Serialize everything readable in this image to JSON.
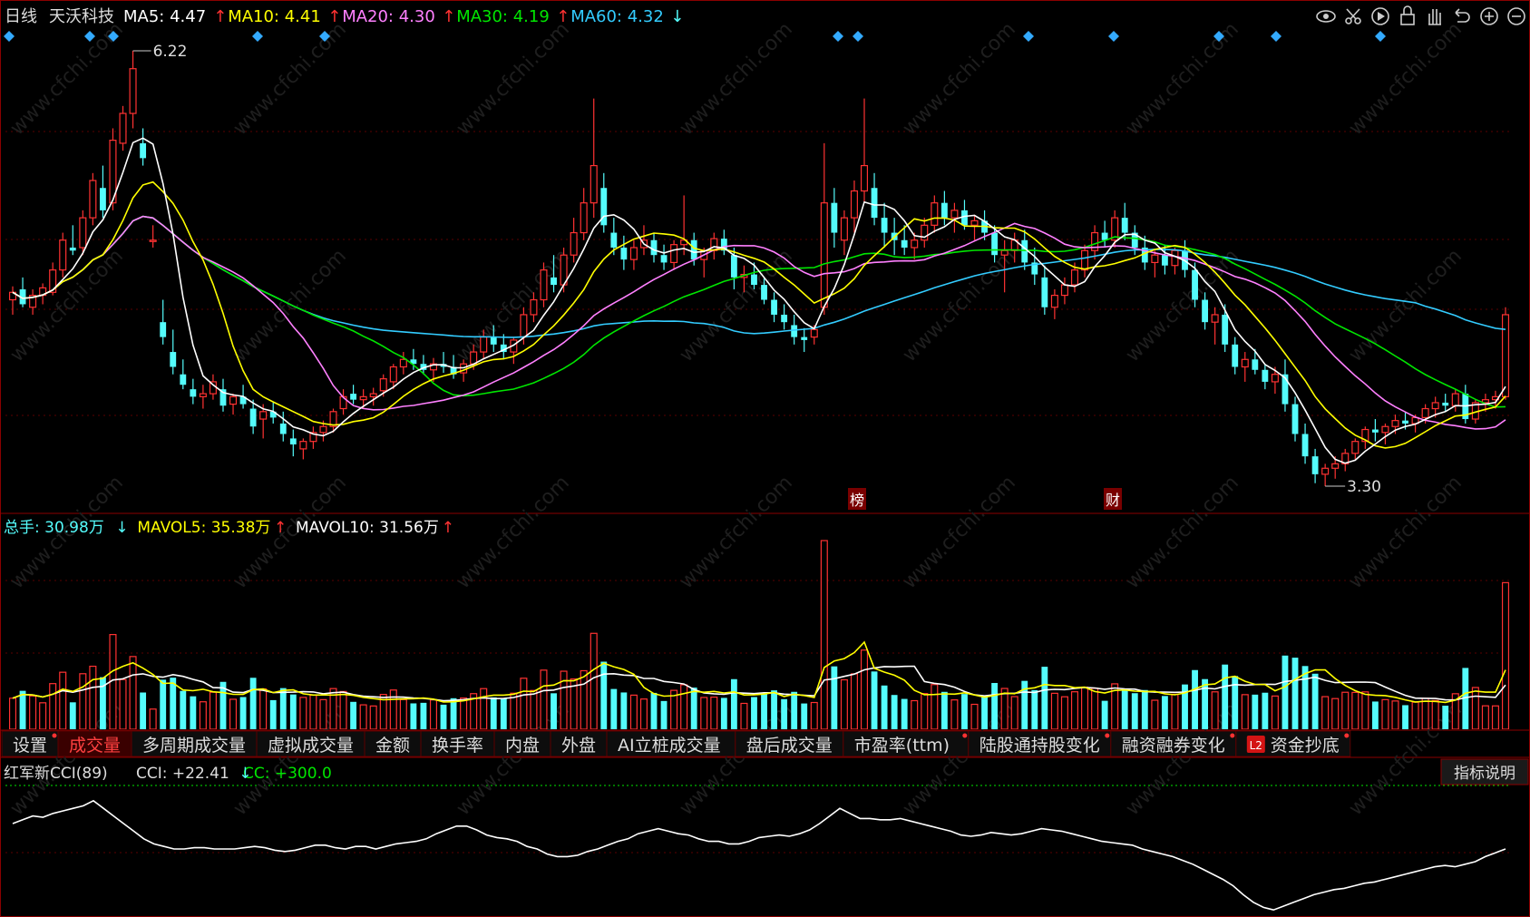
{
  "header": {
    "period": "日线",
    "stock_name": "天沃科技",
    "ma": [
      {
        "label": "MA5: 4.47",
        "arrow": "↑",
        "color": "#ffffff"
      },
      {
        "label": "MA10: 4.41",
        "arrow": "↑",
        "color": "#ffff00"
      },
      {
        "label": "MA20: 4.30",
        "arrow": "↑",
        "color": "#ff80ff"
      },
      {
        "label": "MA30: 4.19",
        "arrow": "↑",
        "color": "#00e600"
      },
      {
        "label": "MA60: 4.32",
        "arrow": "↓",
        "color": "#33ccff"
      }
    ]
  },
  "toolbar_icons": [
    "eye-icon",
    "scissors-icon",
    "replay-icon",
    "lock-icon",
    "hand-icon",
    "undo-icon",
    "zoom-in-icon",
    "zoom-out-icon"
  ],
  "price_panel": {
    "high_label": "6.22",
    "low_label": "3.30",
    "event_marks": [
      "榜",
      "财"
    ],
    "watermark": "www.cfchi.com"
  },
  "volume_panel": {
    "total": {
      "label": "总手: 30.98万",
      "arrow": "↓"
    },
    "mavol5": {
      "label": "MAVOL5: 35.38万",
      "arrow": "↑"
    },
    "mavol10": {
      "label": "MAVOL10: 31.56万",
      "arrow": "↑"
    }
  },
  "tabs": [
    {
      "label": "设置",
      "dot": true
    },
    {
      "label": "成交量",
      "active": true
    },
    {
      "label": "多周期成交量"
    },
    {
      "label": "虚拟成交量"
    },
    {
      "label": "金额"
    },
    {
      "label": "换手率"
    },
    {
      "label": "内盘"
    },
    {
      "label": "外盘"
    },
    {
      "label": "AI立桩成交量"
    },
    {
      "label": "盘后成交量"
    },
    {
      "label": "市盈率(ttm)",
      "dot": true
    },
    {
      "label": "陆股通持股变化",
      "dot": true
    },
    {
      "label": "融资融券变化",
      "dot": true
    },
    {
      "label": "资金抄底",
      "badge": "L2",
      "dot": true
    }
  ],
  "cci_panel": {
    "name": "红军新CCI(89)",
    "cci": "CCI: +22.41",
    "cci_arrow": "↓",
    "cc": "CC: +300.0",
    "explain_button": "指标说明"
  },
  "colors": {
    "up": "#ff3232",
    "down": "#54fcfc",
    "ma5": "#ffffff",
    "ma10": "#ffff00",
    "ma20": "#ff80ff",
    "ma30": "#00e600",
    "ma60": "#33ccff",
    "frame": "#8b0000"
  },
  "chart_data": {
    "type": "candlestick",
    "note_axis": "daily candles, oldest to newest",
    "candles": [
      [
        4.55,
        4.64,
        4.45,
        4.6
      ],
      [
        4.62,
        4.7,
        4.5,
        4.52
      ],
      [
        4.5,
        4.62,
        4.45,
        4.58
      ],
      [
        4.58,
        4.66,
        4.52,
        4.63
      ],
      [
        4.6,
        4.8,
        4.58,
        4.75
      ],
      [
        4.75,
        5.0,
        4.7,
        4.95
      ],
      [
        4.9,
        5.05,
        4.85,
        4.88
      ],
      [
        4.9,
        5.15,
        4.85,
        5.1
      ],
      [
        5.1,
        5.4,
        5.05,
        5.35
      ],
      [
        5.3,
        5.45,
        5.1,
        5.15
      ],
      [
        5.2,
        5.7,
        5.15,
        5.62
      ],
      [
        5.6,
        5.85,
        5.55,
        5.8
      ],
      [
        5.8,
        6.22,
        5.7,
        6.1
      ],
      [
        5.6,
        5.7,
        5.45,
        5.5
      ],
      [
        4.95,
        5.05,
        4.9,
        4.95
      ],
      [
        4.4,
        4.55,
        4.25,
        4.3
      ],
      [
        4.2,
        4.35,
        4.05,
        4.1
      ],
      [
        4.05,
        4.15,
        3.95,
        3.98
      ],
      [
        3.95,
        4.02,
        3.85,
        3.9
      ],
      [
        3.9,
        3.98,
        3.82,
        3.92
      ],
      [
        3.92,
        4.05,
        3.88,
        4.0
      ],
      [
        3.95,
        4.02,
        3.8,
        3.84
      ],
      [
        3.85,
        3.92,
        3.78,
        3.9
      ],
      [
        3.9,
        3.98,
        3.82,
        3.85
      ],
      [
        3.82,
        3.88,
        3.65,
        3.7
      ],
      [
        3.75,
        3.85,
        3.62,
        3.8
      ],
      [
        3.8,
        3.86,
        3.72,
        3.76
      ],
      [
        3.72,
        3.8,
        3.6,
        3.65
      ],
      [
        3.62,
        3.68,
        3.5,
        3.58
      ],
      [
        3.55,
        3.62,
        3.48,
        3.6
      ],
      [
        3.6,
        3.7,
        3.55,
        3.66
      ],
      [
        3.66,
        3.74,
        3.6,
        3.7
      ],
      [
        3.7,
        3.82,
        3.66,
        3.8
      ],
      [
        3.82,
        3.95,
        3.78,
        3.9
      ],
      [
        3.92,
        3.98,
        3.85,
        3.88
      ],
      [
        3.88,
        3.95,
        3.82,
        3.9
      ],
      [
        3.9,
        3.96,
        3.84,
        3.92
      ],
      [
        3.94,
        4.05,
        3.9,
        4.02
      ],
      [
        4.0,
        4.12,
        3.95,
        4.1
      ],
      [
        4.1,
        4.2,
        4.05,
        4.15
      ],
      [
        4.15,
        4.22,
        4.08,
        4.12
      ],
      [
        4.12,
        4.18,
        4.05,
        4.08
      ],
      [
        4.08,
        4.16,
        4.0,
        4.12
      ],
      [
        4.12,
        4.2,
        4.06,
        4.1
      ],
      [
        4.1,
        4.18,
        4.02,
        4.05
      ],
      [
        4.06,
        4.15,
        4.0,
        4.12
      ],
      [
        4.12,
        4.25,
        4.08,
        4.2
      ],
      [
        4.2,
        4.35,
        4.15,
        4.3
      ],
      [
        4.3,
        4.38,
        4.2,
        4.25
      ],
      [
        4.25,
        4.32,
        4.15,
        4.2
      ],
      [
        4.2,
        4.3,
        4.12,
        4.28
      ],
      [
        4.3,
        4.5,
        4.25,
        4.45
      ],
      [
        4.45,
        4.6,
        4.4,
        4.55
      ],
      [
        4.55,
        4.8,
        4.5,
        4.75
      ],
      [
        4.7,
        4.85,
        4.6,
        4.65
      ],
      [
        4.65,
        4.9,
        4.6,
        4.85
      ],
      [
        4.85,
        5.1,
        4.8,
        5.0
      ],
      [
        5.0,
        5.3,
        4.95,
        5.2
      ],
      [
        5.2,
        5.9,
        5.1,
        5.45
      ],
      [
        5.3,
        5.4,
        5.0,
        5.05
      ],
      [
        5.0,
        5.1,
        4.85,
        4.9
      ],
      [
        4.9,
        4.98,
        4.75,
        4.82
      ],
      [
        4.82,
        4.95,
        4.75,
        4.9
      ],
      [
        4.9,
        5.05,
        4.85,
        4.95
      ],
      [
        4.95,
        5.0,
        4.8,
        4.85
      ],
      [
        4.85,
        4.92,
        4.75,
        4.8
      ],
      [
        4.8,
        4.95,
        4.75,
        4.92
      ],
      [
        4.92,
        5.25,
        4.85,
        4.95
      ],
      [
        4.95,
        5.0,
        4.78,
        4.82
      ],
      [
        4.82,
        4.9,
        4.7,
        4.88
      ],
      [
        4.88,
        5.0,
        4.82,
        4.96
      ],
      [
        4.96,
        5.02,
        4.85,
        4.88
      ],
      [
        4.85,
        4.9,
        4.62,
        4.7
      ],
      [
        4.7,
        4.78,
        4.6,
        4.72
      ],
      [
        4.72,
        4.8,
        4.62,
        4.65
      ],
      [
        4.65,
        4.7,
        4.52,
        4.55
      ],
      [
        4.55,
        4.6,
        4.4,
        4.45
      ],
      [
        4.45,
        4.52,
        4.35,
        4.4
      ],
      [
        4.38,
        4.45,
        4.25,
        4.3
      ],
      [
        4.3,
        4.36,
        4.2,
        4.28
      ],
      [
        4.3,
        4.38,
        4.25,
        4.35
      ],
      [
        4.5,
        5.6,
        4.45,
        5.2
      ],
      [
        5.2,
        5.3,
        4.9,
        5.0
      ],
      [
        4.95,
        5.15,
        4.85,
        5.1
      ],
      [
        5.1,
        5.35,
        5.0,
        5.28
      ],
      [
        5.28,
        5.9,
        5.2,
        5.45
      ],
      [
        5.3,
        5.4,
        5.05,
        5.1
      ],
      [
        5.1,
        5.2,
        4.9,
        5.0
      ],
      [
        5.0,
        5.1,
        4.85,
        4.95
      ],
      [
        4.95,
        5.05,
        4.85,
        4.9
      ],
      [
        4.9,
        5.0,
        4.82,
        4.95
      ],
      [
        4.95,
        5.1,
        4.9,
        5.05
      ],
      [
        5.05,
        5.25,
        5.0,
        5.2
      ],
      [
        5.2,
        5.28,
        5.05,
        5.1
      ],
      [
        5.1,
        5.2,
        5.0,
        5.15
      ],
      [
        5.15,
        5.22,
        5.02,
        5.05
      ],
      [
        5.05,
        5.12,
        4.95,
        5.08
      ],
      [
        5.08,
        5.15,
        4.95,
        5.0
      ],
      [
        5.0,
        5.05,
        4.8,
        4.85
      ],
      [
        4.85,
        4.95,
        4.6,
        4.88
      ],
      [
        4.88,
        5.0,
        4.8,
        4.95
      ],
      [
        4.95,
        5.02,
        4.75,
        4.8
      ],
      [
        4.8,
        4.9,
        4.65,
        4.72
      ],
      [
        4.7,
        4.78,
        4.45,
        4.5
      ],
      [
        4.5,
        4.62,
        4.42,
        4.58
      ],
      [
        4.58,
        4.7,
        4.52,
        4.65
      ],
      [
        4.65,
        4.8,
        4.6,
        4.75
      ],
      [
        4.75,
        4.92,
        4.7,
        4.88
      ],
      [
        4.88,
        5.05,
        4.82,
        5.0
      ],
      [
        5.0,
        5.08,
        4.9,
        4.95
      ],
      [
        4.95,
        5.15,
        4.9,
        5.1
      ],
      [
        5.1,
        5.2,
        4.95,
        5.0
      ],
      [
        5.0,
        5.05,
        4.85,
        4.9
      ],
      [
        4.9,
        4.98,
        4.75,
        4.8
      ],
      [
        4.8,
        4.88,
        4.7,
        4.85
      ],
      [
        4.85,
        4.92,
        4.72,
        4.78
      ],
      [
        4.78,
        4.9,
        4.72,
        4.88
      ],
      [
        4.88,
        4.95,
        4.7,
        4.75
      ],
      [
        4.75,
        4.8,
        4.5,
        4.55
      ],
      [
        4.55,
        4.6,
        4.35,
        4.4
      ],
      [
        4.4,
        4.5,
        4.25,
        4.45
      ],
      [
        4.45,
        4.52,
        4.2,
        4.25
      ],
      [
        4.25,
        4.3,
        4.05,
        4.1
      ],
      [
        4.1,
        4.2,
        4.0,
        4.15
      ],
      [
        4.15,
        4.22,
        4.05,
        4.08
      ],
      [
        4.08,
        4.12,
        3.95,
        4.0
      ],
      [
        4.0,
        4.1,
        3.92,
        4.05
      ],
      [
        4.05,
        4.15,
        3.8,
        3.85
      ],
      [
        3.85,
        3.9,
        3.6,
        3.65
      ],
      [
        3.65,
        3.72,
        3.45,
        3.5
      ],
      [
        3.5,
        3.55,
        3.32,
        3.38
      ],
      [
        3.38,
        3.45,
        3.3,
        3.42
      ],
      [
        3.42,
        3.5,
        3.35,
        3.45
      ],
      [
        3.45,
        3.55,
        3.4,
        3.52
      ],
      [
        3.52,
        3.62,
        3.48,
        3.6
      ],
      [
        3.6,
        3.7,
        3.55,
        3.68
      ],
      [
        3.68,
        3.75,
        3.6,
        3.66
      ],
      [
        3.66,
        3.72,
        3.58,
        3.7
      ],
      [
        3.7,
        3.78,
        3.65,
        3.74
      ],
      [
        3.74,
        3.8,
        3.68,
        3.72
      ],
      [
        3.72,
        3.78,
        3.66,
        3.76
      ],
      [
        3.76,
        3.85,
        3.72,
        3.82
      ],
      [
        3.82,
        3.9,
        3.76,
        3.86
      ],
      [
        3.86,
        3.92,
        3.8,
        3.84
      ],
      [
        3.84,
        3.95,
        3.8,
        3.92
      ],
      [
        3.92,
        3.98,
        3.72,
        3.75
      ],
      [
        3.75,
        3.88,
        3.72,
        3.86
      ],
      [
        3.86,
        3.92,
        3.8,
        3.88
      ],
      [
        3.88,
        3.94,
        3.82,
        3.9
      ],
      [
        3.9,
        4.5,
        3.88,
        4.45
      ]
    ],
    "cci": [
      52,
      55,
      58,
      57,
      60,
      62,
      64,
      66,
      70,
      64,
      58,
      52,
      46,
      40,
      36,
      34,
      32,
      32,
      33,
      33,
      32,
      32,
      32,
      33,
      34,
      33,
      31,
      30,
      31,
      33,
      35,
      35,
      33,
      32,
      34,
      34,
      32,
      34,
      36,
      37,
      38,
      40,
      44,
      47,
      50,
      50,
      47,
      43,
      41,
      40,
      38,
      34,
      32,
      28,
      26,
      26,
      27,
      30,
      32,
      35,
      38,
      40,
      44,
      46,
      48,
      46,
      44,
      43,
      40,
      38,
      38,
      36,
      36,
      38,
      41,
      42,
      43,
      42,
      44,
      47,
      52,
      58,
      64,
      60,
      56,
      56,
      55,
      55,
      56,
      54,
      52,
      50,
      48,
      46,
      43,
      42,
      43,
      45,
      44,
      43,
      44,
      46,
      48,
      47,
      46,
      44,
      42,
      40,
      38,
      37,
      36,
      35,
      32,
      30,
      28,
      26,
      23,
      20,
      16,
      12,
      8,
      3,
      -4,
      -10,
      -14,
      -16,
      -13,
      -10,
      -7,
      -4,
      -2,
      0,
      1,
      3,
      5,
      6,
      8,
      10,
      12,
      14,
      16,
      18,
      19,
      18,
      20,
      22,
      26,
      29,
      32
    ]
  }
}
